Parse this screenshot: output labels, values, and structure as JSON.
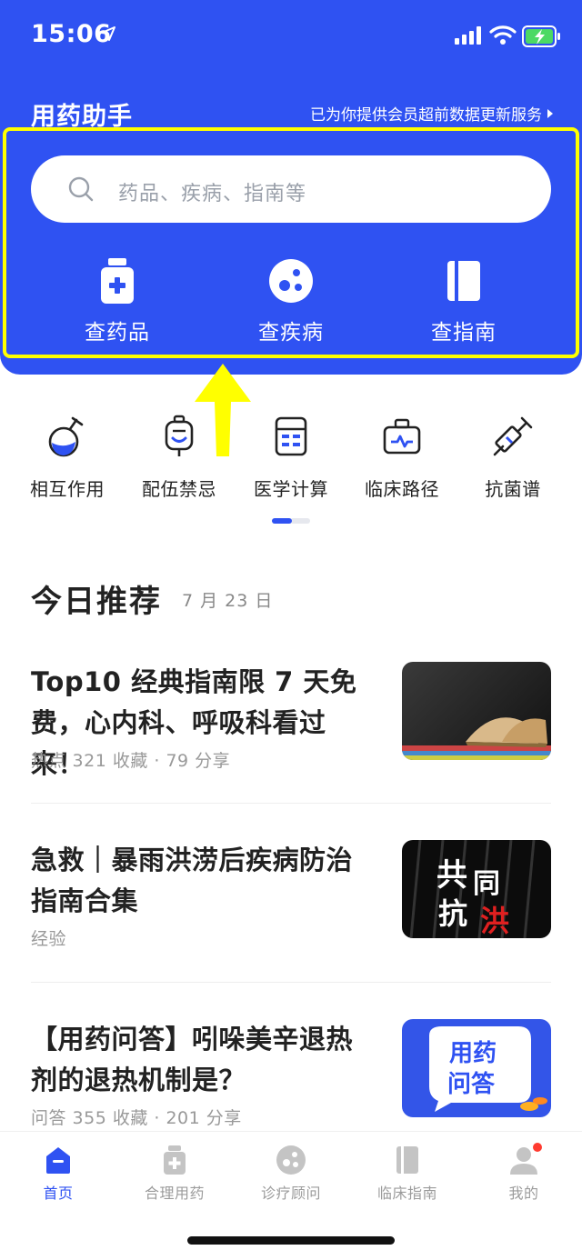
{
  "status_bar": {
    "time": "15:06"
  },
  "header": {
    "title": "用药助手",
    "member_link": "已为你提供会员超前数据更新服务",
    "search_placeholder": "药品、疾病、指南等",
    "quick_actions": [
      {
        "label": "查药品",
        "icon": "medicine-bottle-icon"
      },
      {
        "label": "查疾病",
        "icon": "disease-icon"
      },
      {
        "label": "查指南",
        "icon": "guide-book-icon"
      }
    ],
    "accent_color": "#2f52f2",
    "highlight_color": "#ffff00"
  },
  "tools": [
    {
      "label": "相互作用",
      "icon": "flask-icon"
    },
    {
      "label": "配伍禁忌",
      "icon": "iv-bag-icon"
    },
    {
      "label": "医学计算",
      "icon": "calculator-icon"
    },
    {
      "label": "临床路径",
      "icon": "medical-kit-icon"
    },
    {
      "label": "抗菌谱",
      "icon": "syringe-icon"
    }
  ],
  "recommend": {
    "title": "今日推荐",
    "date": "7 月 23 日",
    "articles": [
      {
        "title": "Top10 经典指南限 7 天免费，心内科、呼吸科看过来！",
        "meta": "热点   321 收藏 · 79 分享",
        "thumb": "books-thumbnail"
      },
      {
        "title": "急救｜暴雨洪涝后疾病防治指南合集",
        "meta": "经验",
        "thumb": "flood-thumbnail"
      },
      {
        "title": "【用药问答】吲哚美辛退热剂的退热机制是？",
        "meta": "问答   355 收藏 · 201 分享",
        "thumb": "qa-thumbnail"
      }
    ]
  },
  "thumb_text": {
    "flood_1": "共",
    "flood_2": "同",
    "flood_3": "抗",
    "flood_4": "洪",
    "qa_1": "用药",
    "qa_2": "问答"
  },
  "tabbar": [
    {
      "label": "首页",
      "icon": "home-icon",
      "active": true
    },
    {
      "label": "合理用药",
      "icon": "medicine-icon",
      "active": false
    },
    {
      "label": "诊疗顾问",
      "icon": "consult-icon",
      "active": false
    },
    {
      "label": "临床指南",
      "icon": "guide-icon",
      "active": false
    },
    {
      "label": "我的",
      "icon": "profile-icon",
      "active": false
    }
  ]
}
